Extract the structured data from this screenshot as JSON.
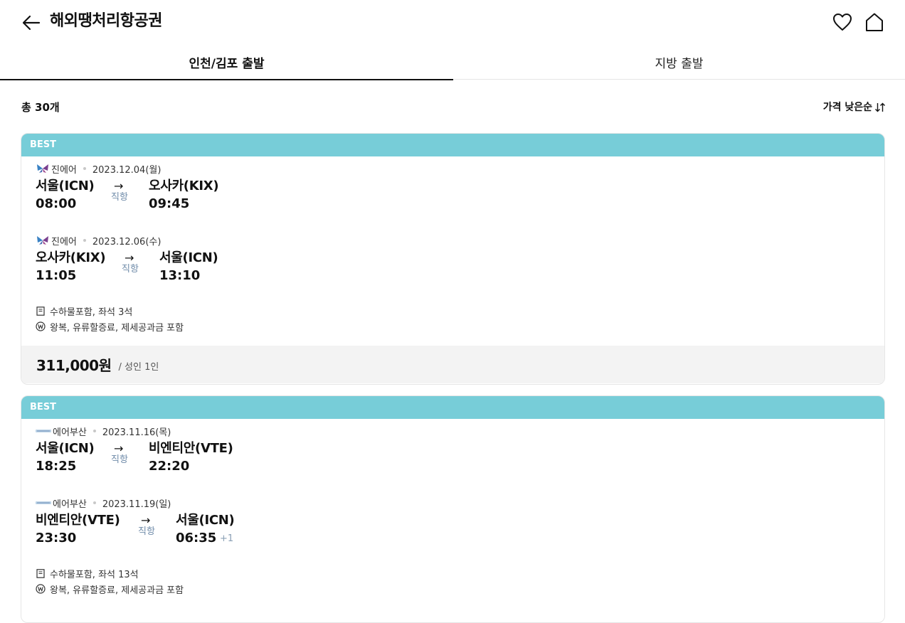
{
  "header": {
    "title": "해외땡처리항공권",
    "back_icon": "arrow-left-icon",
    "favorite_icon": "heart-icon",
    "home_icon": "home-icon"
  },
  "tabs": [
    {
      "label": "인천/김포 출발",
      "active": true
    },
    {
      "label": "지방 출발",
      "active": false
    }
  ],
  "summary": {
    "total": "총 30개",
    "sort_label": "가격 낮은순",
    "sort_icon": "sort-arrows-icon"
  },
  "colors": {
    "badge": "#77cdd8",
    "direct_text": "#6f8ba9",
    "price_bar": "#f3f3f3"
  },
  "results": [
    {
      "badge": "BEST",
      "legs": [
        {
          "airline": "진에어",
          "airline_icon": "jinair-logo-icon",
          "date": "2023.12.04(월)",
          "from": "서울(ICN)",
          "to": "오사카(KIX)",
          "depart_time": "08:00",
          "arrive_time": "09:45",
          "arrow": "→",
          "route_type": "직항",
          "plus_day": ""
        },
        {
          "airline": "진에어",
          "airline_icon": "jinair-logo-icon",
          "date": "2023.12.06(수)",
          "from": "오사카(KIX)",
          "to": "서울(ICN)",
          "depart_time": "11:05",
          "arrive_time": "13:10",
          "arrow": "→",
          "route_type": "직항",
          "plus_day": ""
        }
      ],
      "info": {
        "baggage": "수하물포함, 좌석 3석",
        "fare": "왕복, 유류할증료, 제세공과금 포함"
      },
      "price": "311,000원",
      "price_unit": "/ 성인 1인"
    },
    {
      "badge": "BEST",
      "legs": [
        {
          "airline": "에어부산",
          "airline_icon": "airbusan-logo-icon",
          "date": "2023.11.16(목)",
          "from": "서울(ICN)",
          "to": "비엔티안(VTE)",
          "depart_time": "18:25",
          "arrive_time": "22:20",
          "arrow": "→",
          "route_type": "직항",
          "plus_day": ""
        },
        {
          "airline": "에어부산",
          "airline_icon": "airbusan-logo-icon",
          "date": "2023.11.19(일)",
          "from": "비엔티안(VTE)",
          "to": "서울(ICN)",
          "depart_time": "23:30",
          "arrive_time": "06:35",
          "arrow": "→",
          "route_type": "직항",
          "plus_day": "+1"
        }
      ],
      "info": {
        "baggage": "수하물포함, 좌석 13석",
        "fare": "왕복, 유류할증료, 제세공과금 포함"
      }
    }
  ]
}
